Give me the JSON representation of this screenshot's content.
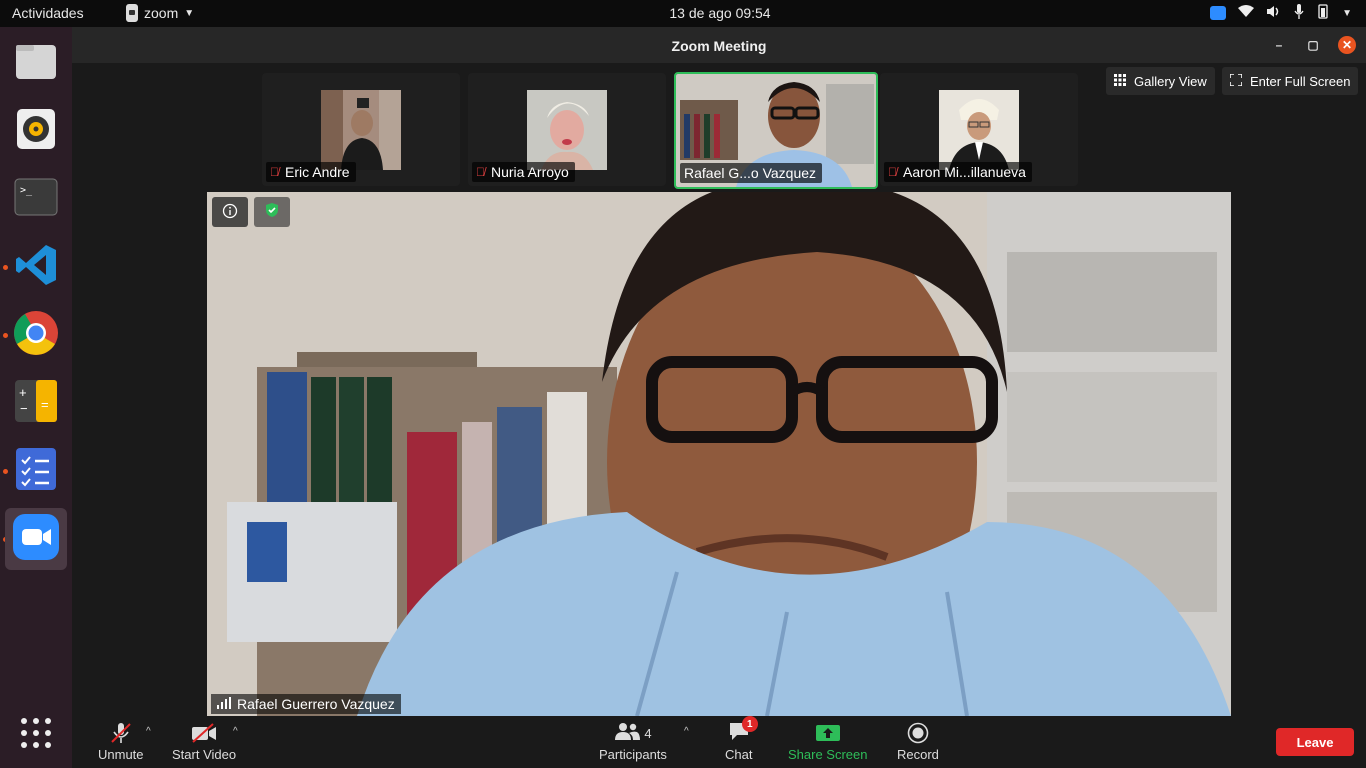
{
  "topbar": {
    "activities": "Actividades",
    "app_name": "zoom",
    "clock": "13 de ago  09:54"
  },
  "window": {
    "title": "Zoom Meeting",
    "minimize": "–",
    "maximize": "▢",
    "close": "✕"
  },
  "view": {
    "gallery_label": "Gallery View",
    "fullscreen_label": "Enter Full Screen"
  },
  "participants_strip": [
    {
      "name": "Eric Andre",
      "muted": true
    },
    {
      "name": "Nuria Arroyo",
      "muted": true
    },
    {
      "name": "Rafael G...o Vazquez",
      "muted": false,
      "active": true
    },
    {
      "name": "Aaron Mi...illanueva",
      "muted": true
    }
  ],
  "stage": {
    "speaker_name": "Rafael Guerrero Vazquez"
  },
  "toolbar": {
    "unmute": "Unmute",
    "start_video": "Start Video",
    "participants": "Participants",
    "participants_count": "4",
    "chat": "Chat",
    "chat_badge": "1",
    "share_screen": "Share Screen",
    "record": "Record",
    "leave": "Leave"
  },
  "colors": {
    "accent_green": "#2ebd59",
    "leave_red": "#e02828",
    "ubuntu_orange": "#e95420"
  }
}
